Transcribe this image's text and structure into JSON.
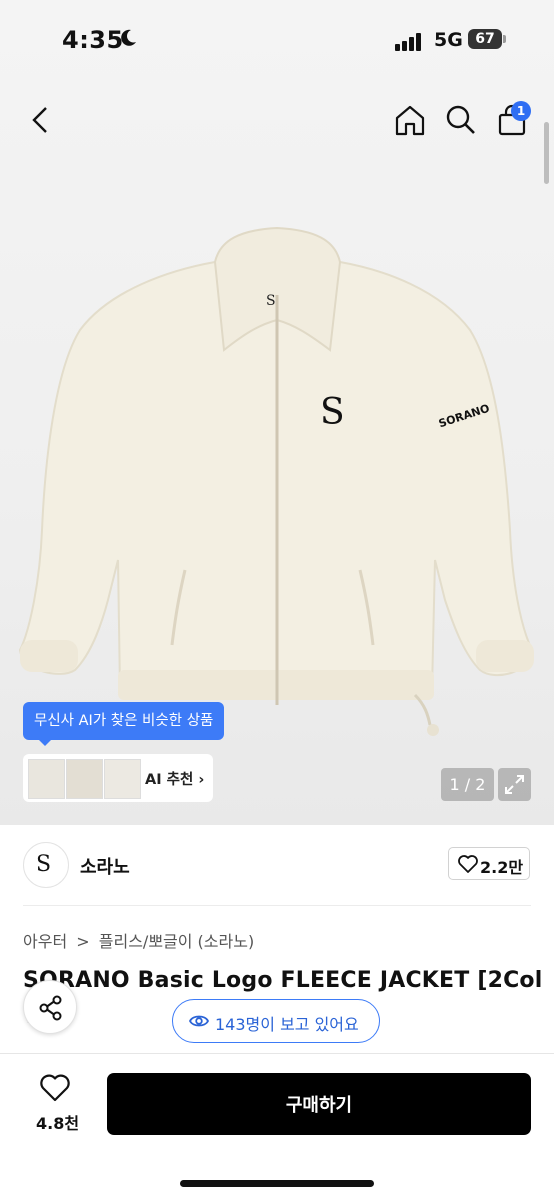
{
  "status_bar": {
    "time": "4:35",
    "network": "5G",
    "battery": "67"
  },
  "nav": {
    "back_icon": "chevron-left-icon",
    "home_icon": "home-icon",
    "search_icon": "search-icon",
    "cart_icon": "shopping-bag-icon",
    "cart_badge": "1"
  },
  "product_image": {
    "brand_mark": "S",
    "sleeve_text": "SORANO",
    "pager": "1 / 2"
  },
  "ai_recommend": {
    "tooltip": "무신사 AI가 찾은 비슷한 상품",
    "label": "AI 추천",
    "chevron": "›"
  },
  "brand": {
    "name": "소라노",
    "likes": "2.2만"
  },
  "breadcrumb": {
    "category": "아우터",
    "separator": ">",
    "subcategory": "플리스/뽀글이 (소라노)"
  },
  "product": {
    "title": "SORANO Basic Logo FLEECE JACKET [2Col",
    "title_line2": "("
  },
  "viewers": {
    "text": "143명이 보고 있어요"
  },
  "bottom_bar": {
    "wish_count": "4.8천",
    "buy_label": "구매하기"
  },
  "colors": {
    "accent": "#3d7bf7",
    "buy_button": "#000000",
    "jacket": "#f3efe2"
  }
}
